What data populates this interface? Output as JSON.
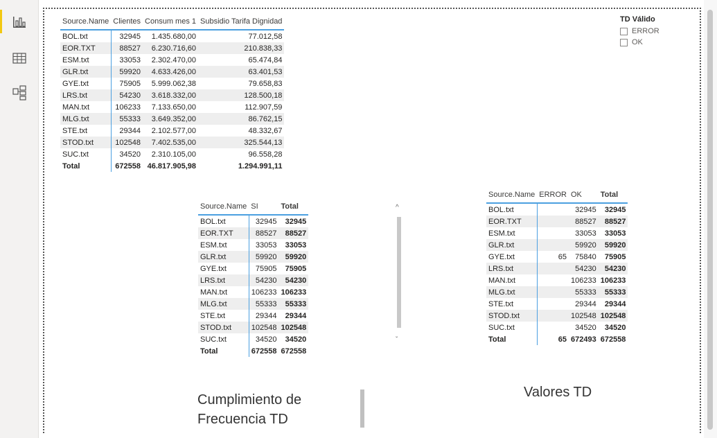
{
  "nav": {
    "items": [
      {
        "name": "report-view",
        "icon": "bar-chart-icon"
      },
      {
        "name": "data-view",
        "icon": "table-grid-icon"
      },
      {
        "name": "model-view",
        "icon": "model-relationship-icon"
      }
    ]
  },
  "table_main": {
    "headers": [
      "Source.Name",
      "Clientes",
      "Consum mes 1",
      "Subsidio Tarifa Dignidad"
    ],
    "rows": [
      [
        "BOL.txt",
        "32945",
        "1.435.680,00",
        "77.012,58"
      ],
      [
        "EOR.TXT",
        "88527",
        "6.230.716,60",
        "210.838,33"
      ],
      [
        "ESM.txt",
        "33053",
        "2.302.470,00",
        "65.474,84"
      ],
      [
        "GLR.txt",
        "59920",
        "4.633.426,00",
        "63.401,53"
      ],
      [
        "GYE.txt",
        "75905",
        "5.999.062,38",
        "79.658,83"
      ],
      [
        "LRS.txt",
        "54230",
        "3.618.332,00",
        "128.500,18"
      ],
      [
        "MAN.txt",
        "106233",
        "7.133.650,00",
        "112.907,59"
      ],
      [
        "MLG.txt",
        "55333",
        "3.649.352,00",
        "86.762,15"
      ],
      [
        "STE.txt",
        "29344",
        "2.102.577,00",
        "48.332,67"
      ],
      [
        "STOD.txt",
        "102548",
        "7.402.535,00",
        "325.544,13"
      ],
      [
        "SUC.txt",
        "34520",
        "2.310.105,00",
        "96.558,28"
      ]
    ],
    "total": [
      "Total",
      "672558",
      "46.817.905,98",
      "1.294.991,11"
    ]
  },
  "slicer": {
    "title": "TD Válido",
    "options": [
      "ERROR",
      "OK"
    ]
  },
  "table_si": {
    "headers": [
      "Source.Name",
      "SI",
      "Total"
    ],
    "rows": [
      [
        "BOL.txt",
        "32945",
        "32945"
      ],
      [
        "EOR.TXT",
        "88527",
        "88527"
      ],
      [
        "ESM.txt",
        "33053",
        "33053"
      ],
      [
        "GLR.txt",
        "59920",
        "59920"
      ],
      [
        "GYE.txt",
        "75905",
        "75905"
      ],
      [
        "LRS.txt",
        "54230",
        "54230"
      ],
      [
        "MAN.txt",
        "106233",
        "106233"
      ],
      [
        "MLG.txt",
        "55333",
        "55333"
      ],
      [
        "STE.txt",
        "29344",
        "29344"
      ],
      [
        "STOD.txt",
        "102548",
        "102548"
      ],
      [
        "SUC.txt",
        "34520",
        "34520"
      ]
    ],
    "total": [
      "Total",
      "672558",
      "672558"
    ]
  },
  "table_td": {
    "headers": [
      "Source.Name",
      "ERROR",
      "OK",
      "Total"
    ],
    "rows": [
      [
        "BOL.txt",
        "",
        "32945",
        "32945"
      ],
      [
        "EOR.TXT",
        "",
        "88527",
        "88527"
      ],
      [
        "ESM.txt",
        "",
        "33053",
        "33053"
      ],
      [
        "GLR.txt",
        "",
        "59920",
        "59920"
      ],
      [
        "GYE.txt",
        "65",
        "75840",
        "75905"
      ],
      [
        "LRS.txt",
        "",
        "54230",
        "54230"
      ],
      [
        "MAN.txt",
        "",
        "106233",
        "106233"
      ],
      [
        "MLG.txt",
        "",
        "55333",
        "55333"
      ],
      [
        "STE.txt",
        "",
        "29344",
        "29344"
      ],
      [
        "STOD.txt",
        "",
        "102548",
        "102548"
      ],
      [
        "SUC.txt",
        "",
        "34520",
        "34520"
      ]
    ],
    "total": [
      "Total",
      "65",
      "672493",
      "672558"
    ]
  },
  "labels": {
    "frecuencia": "Cumplimiento de Frecuencia TD",
    "valores": "Valores TD"
  },
  "colors": {
    "accent": "#4a9fe0",
    "nav_active": "#f2c811"
  }
}
